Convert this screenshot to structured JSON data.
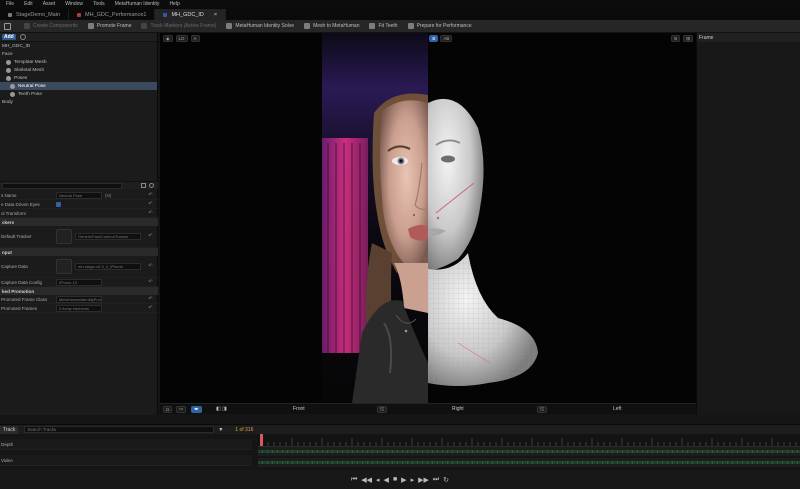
{
  "menu": [
    "File",
    "Edit",
    "Asset",
    "Window",
    "Tools",
    "MetaHuman Identity",
    "Help"
  ],
  "tabs": [
    {
      "label": "StageDemo_Main",
      "color": "#7a7a7a",
      "active": false
    },
    {
      "label": "MH_GDC_Performance1",
      "color": "#b33a3a",
      "active": false
    },
    {
      "label": "MH_GDC_ID",
      "color": "#3a56b3",
      "active": true
    }
  ],
  "toolbar": {
    "items": [
      {
        "label": "Create Components",
        "enabled": false
      },
      {
        "label": "Promote Frame",
        "enabled": true
      },
      {
        "label": "Track Markers (Active Frame)",
        "enabled": false
      },
      {
        "label": "MetaHuman Identity Solve",
        "enabled": true
      },
      {
        "label": "Mesh to MetaHuman",
        "enabled": true
      },
      {
        "label": "Fit Teeth",
        "enabled": true
      },
      {
        "label": "Prepare for Performance",
        "enabled": true
      }
    ]
  },
  "left_panel": {
    "add_label": "Add",
    "tree": [
      {
        "label": "MH_GDC_ID",
        "indent": 0,
        "selected": false
      },
      {
        "label": "Face",
        "indent": 0,
        "selected": false
      },
      {
        "label": "Template Mesh",
        "indent": 1,
        "selected": false
      },
      {
        "label": "Skeletal Mesh",
        "indent": 1,
        "selected": false
      },
      {
        "label": "Poses",
        "indent": 1,
        "selected": false
      },
      {
        "label": "Neutral Pose",
        "indent": 2,
        "selected": true
      },
      {
        "label": "Teeth Pose",
        "indent": 2,
        "selected": false
      },
      {
        "label": "Body",
        "indent": 0,
        "selected": false
      }
    ],
    "details": [
      {
        "type": "row",
        "key": "s Name",
        "value": "Neutral Pose",
        "extra": "(N)"
      },
      {
        "type": "row",
        "key": "e Data Driven Eyes",
        "check": true
      },
      {
        "type": "row",
        "key": "ol Transform",
        "value": ""
      },
      {
        "type": "section",
        "label": "ckers"
      },
      {
        "type": "row",
        "key": "Default Tracker",
        "value": "GenericFaceContourTracker",
        "thumb": true
      },
      {
        "type": "section",
        "label": "nput"
      },
      {
        "type": "row",
        "key": "Capture Data",
        "value": "mh-stage-v0-0_0_iPhone",
        "thumb": true
      },
      {
        "type": "row",
        "key": "Capture Data Config",
        "value": "iPhone 13"
      },
      {
        "type": "section",
        "label": "ked Promotion"
      },
      {
        "type": "row",
        "key": "Promoted Frame Class",
        "value": "MetaHumanIdentityPromotedF..."
      },
      {
        "type": "row",
        "key": "Promoted Frames",
        "value": "0 Array elements"
      }
    ]
  },
  "viewport": {
    "lod_label": "LO",
    "mode_buttons": [
      "A",
      "B",
      "AB"
    ],
    "active_mode": 1,
    "footer_labels": [
      "Front",
      "Right",
      "Left"
    ]
  },
  "right_panel": {
    "title": "Frame"
  },
  "timeline": {
    "header": "Track",
    "search_placeholder": "Search Tracks",
    "frame_counter": "1 of 316",
    "tracks": [
      "Depth",
      "Video"
    ],
    "transport_icons": [
      "skip-start",
      "prev-key",
      "step-back",
      "play-reverse",
      "stop",
      "play",
      "step-forward",
      "next-key",
      "skip-end",
      "loop"
    ]
  },
  "colors": {
    "accent": "#2f64a3",
    "selection": "#3a4a5c",
    "playhead": "#d65c5c",
    "track_green": "#2d5e3b"
  }
}
